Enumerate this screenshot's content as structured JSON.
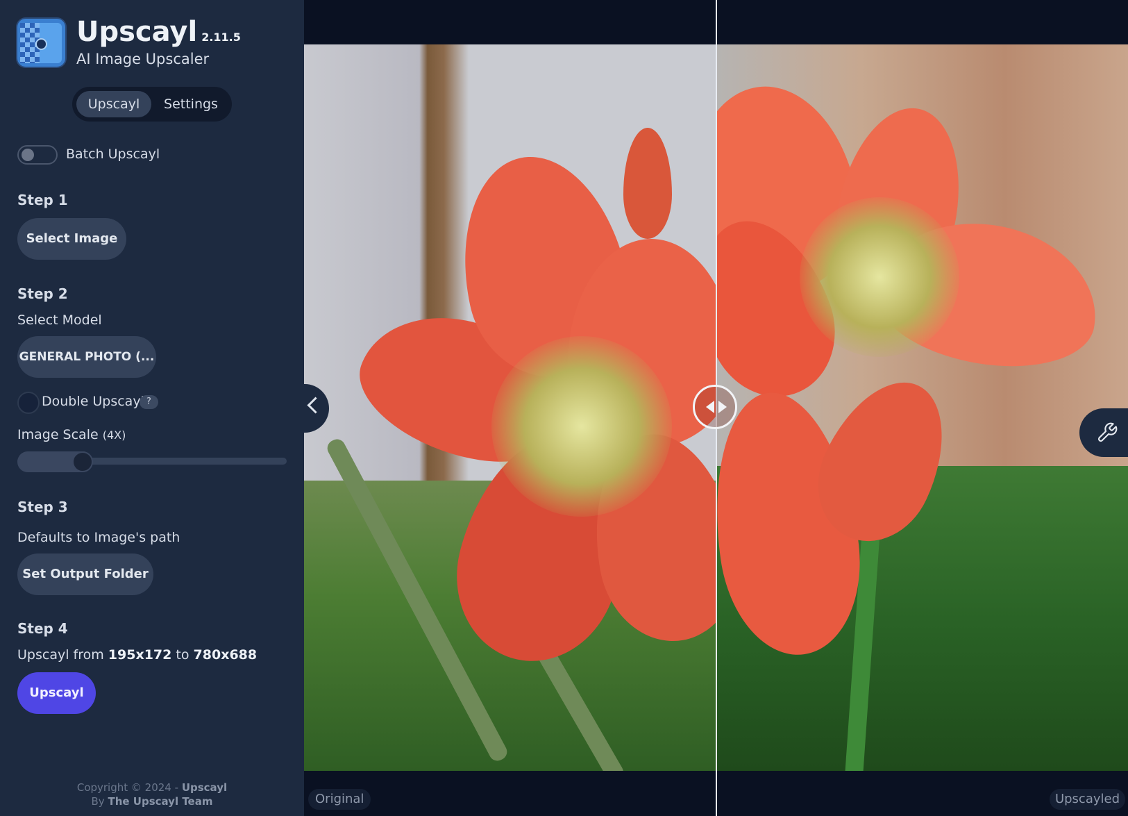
{
  "app": {
    "title": "Upscayl",
    "version": "2.11.5",
    "subtitle": "AI Image Upscaler"
  },
  "tabs": [
    {
      "label": "Upscayl",
      "active": true
    },
    {
      "label": "Settings",
      "active": false
    }
  ],
  "batch": {
    "label": "Batch Upscayl",
    "enabled": false
  },
  "step1": {
    "title": "Step 1",
    "button": "Select Image"
  },
  "step2": {
    "title": "Step 2",
    "model_label": "Select Model",
    "model_value": "GENERAL PHOTO (...",
    "double_label": "Double Upscayl",
    "double_checked": false,
    "help": "?",
    "scale_label": "Image Scale",
    "scale_value": "(4X)",
    "scale_fraction": 0.22
  },
  "step3": {
    "title": "Step 3",
    "text": "Defaults to Image's path",
    "button": "Set Output Folder"
  },
  "step4": {
    "title": "Step 4",
    "prefix": "Upscayl from",
    "from": "195x172",
    "middle": "to",
    "to": "780x688",
    "button": "Upscayl"
  },
  "footer": {
    "copyright": "Copyright © 2024 -",
    "brand": "Upscayl",
    "by": "By",
    "team": "The Upscayl Team"
  },
  "viewer": {
    "label_left": "Original",
    "label_right": "Upscayled",
    "split_fraction": 0.5
  },
  "icons": {
    "collapse": "chevron-left-icon",
    "tools": "wrench-icon",
    "divider": "compare-arrows-icon"
  },
  "colors": {
    "sidebar": "#1d2a40",
    "primary": "#4f46e5",
    "background": "#0a1122"
  }
}
